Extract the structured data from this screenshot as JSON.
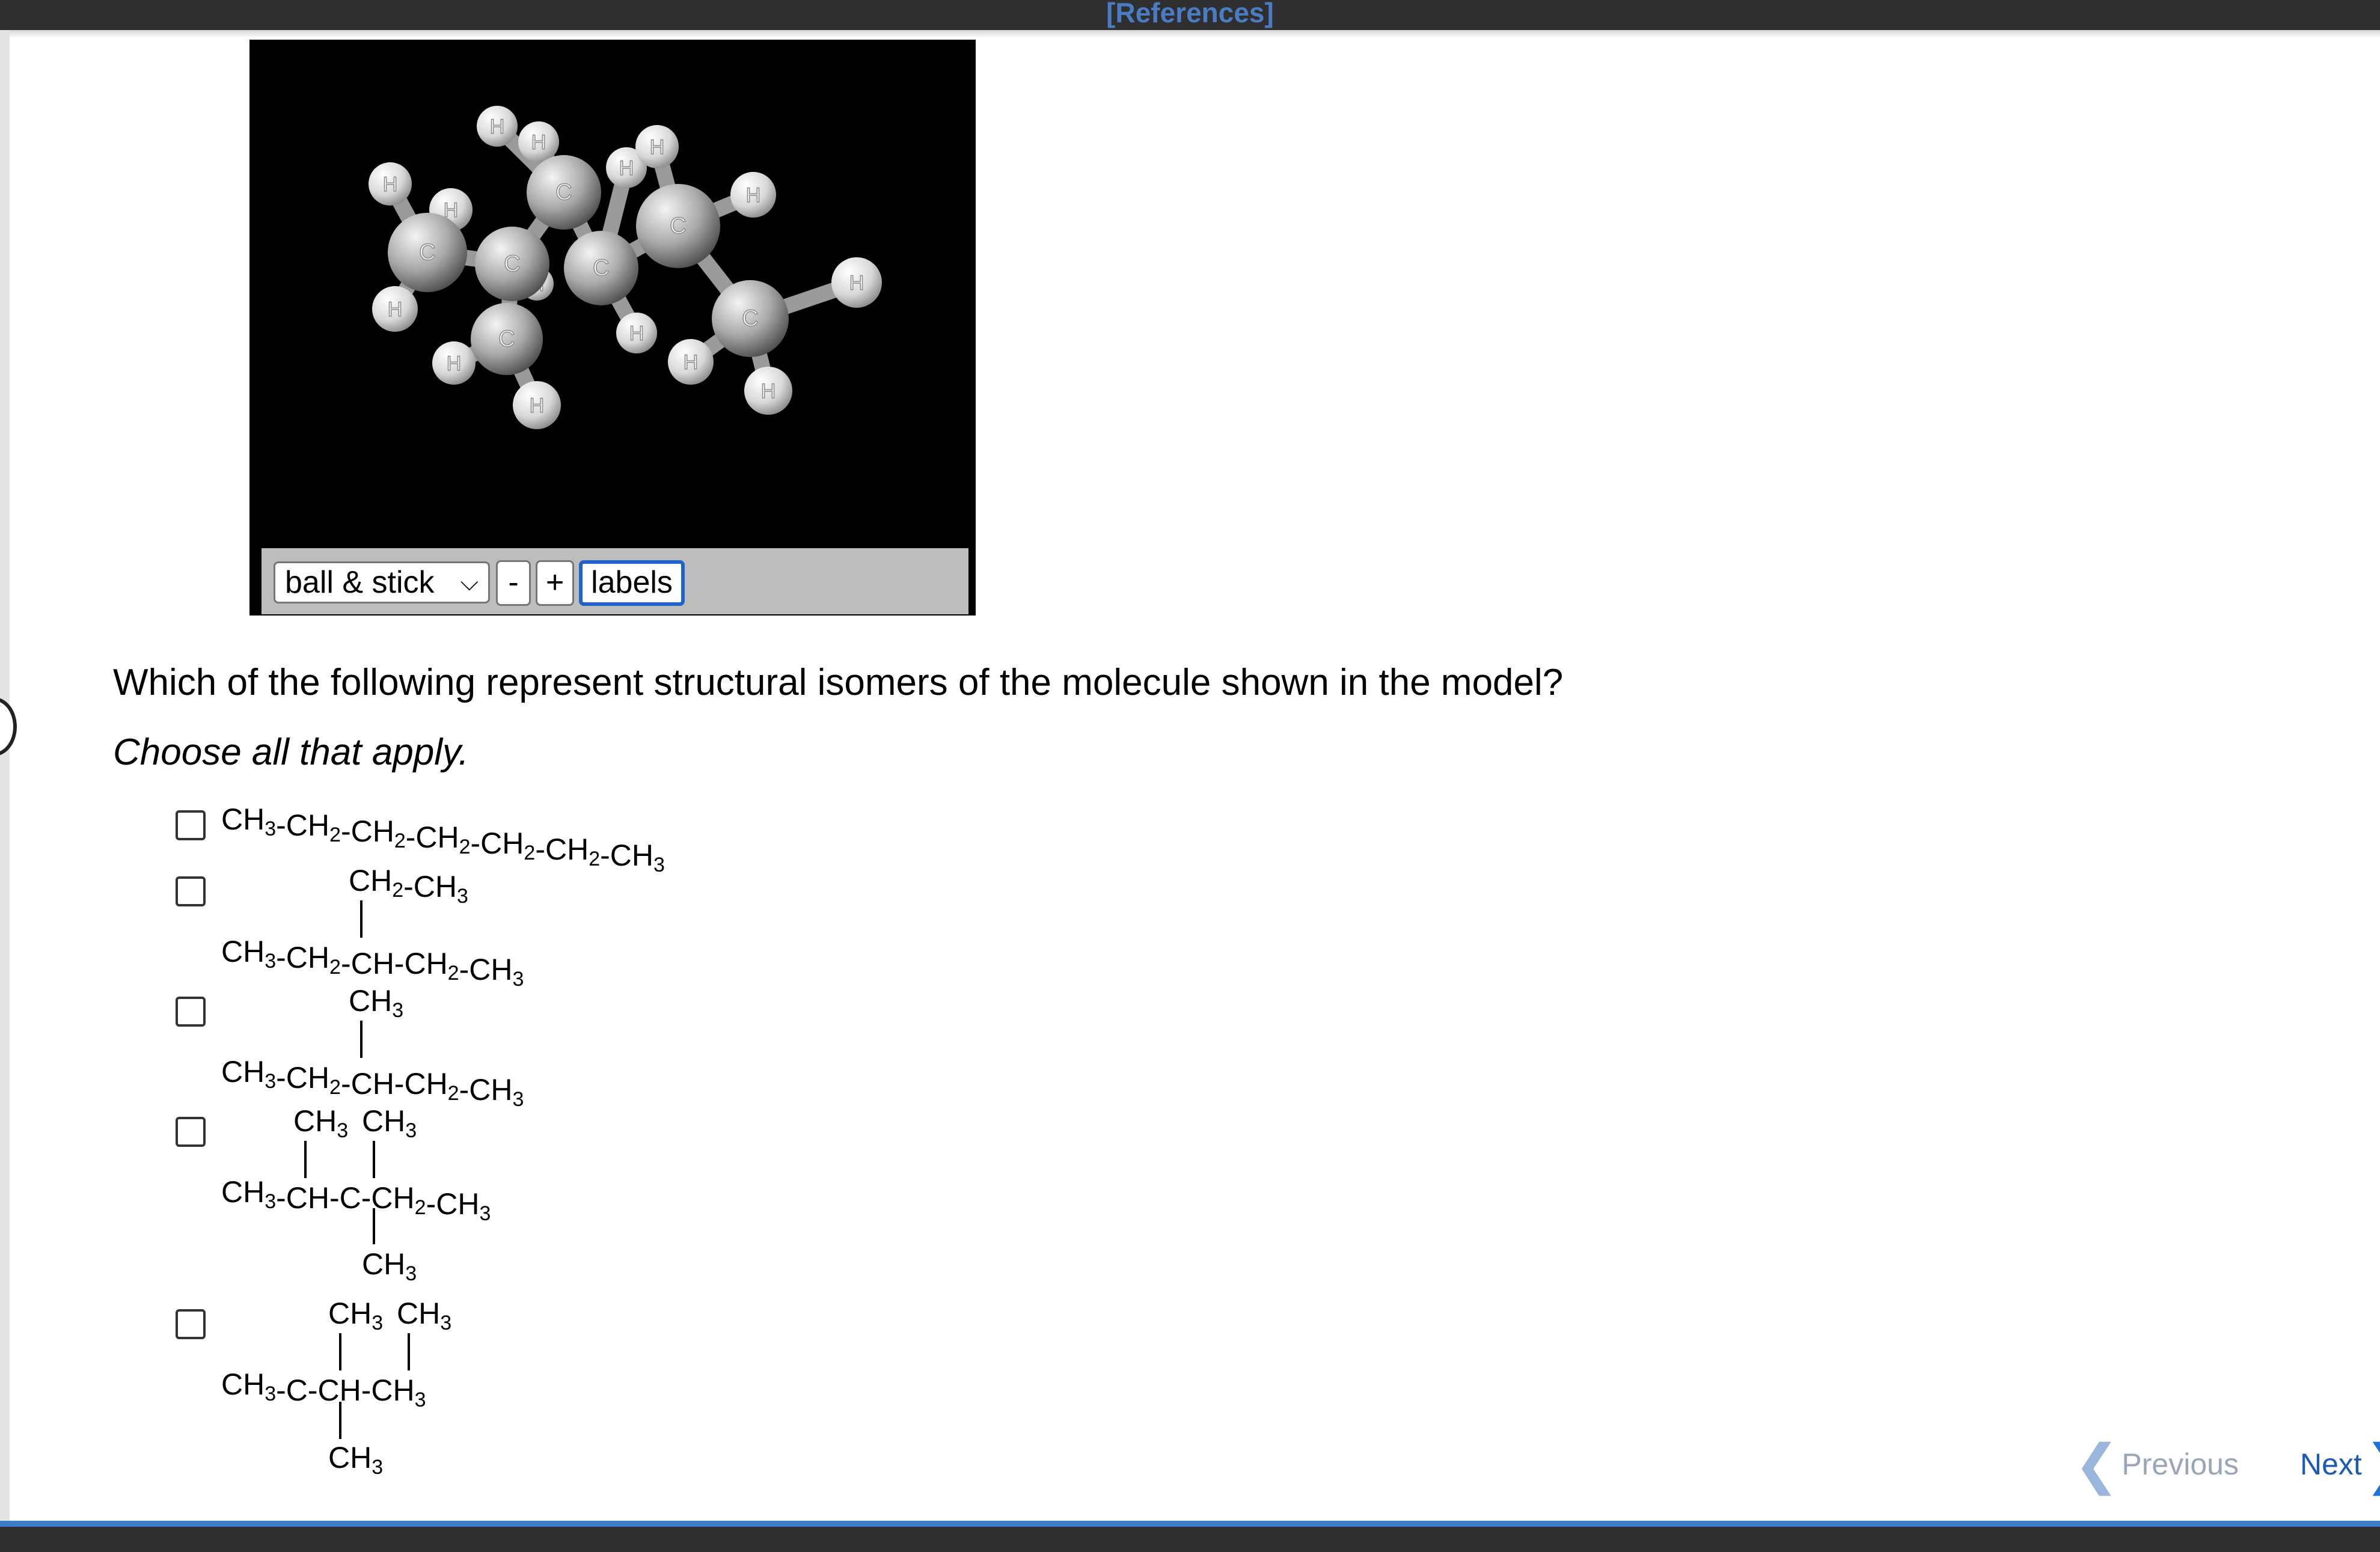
{
  "header": {
    "references_link": "[References]"
  },
  "viewer": {
    "atom_labels": {
      "carbon": "C",
      "hydrogen": "H"
    },
    "toolbar": {
      "style_select_value": "ball & stick",
      "zoom_out_label": "-",
      "zoom_in_label": "+",
      "labels_button": "labels"
    }
  },
  "question": {
    "prompt": "Which of the following represent structural isomers of the molecule shown in the model?",
    "instruction": "Choose all that apply."
  },
  "options": [
    {
      "main_chain": "CH3-CH2-CH2-CH2-CH2-CH2-CH3",
      "checked": false
    },
    {
      "substituent": "CH2-CH3",
      "main_chain": "CH3-CH2-CH-CH2-CH3",
      "checked": false
    },
    {
      "substituent": "CH3",
      "main_chain": "CH3-CH2-CH-CH2-CH3",
      "checked": false
    },
    {
      "substituents": [
        "CH3",
        "CH3",
        "CH3"
      ],
      "main_chain": "CH3-CH-C-CH2-CH3",
      "checked": false
    },
    {
      "substituents": [
        "CH3",
        "CH3",
        "CH3"
      ],
      "main_chain": "CH3-C-CH-CH3",
      "checked": false
    }
  ],
  "navigation": {
    "previous_label": "Previous",
    "next_label": "Next",
    "previous_arrow": "❮",
    "next_arrow": "❯"
  }
}
